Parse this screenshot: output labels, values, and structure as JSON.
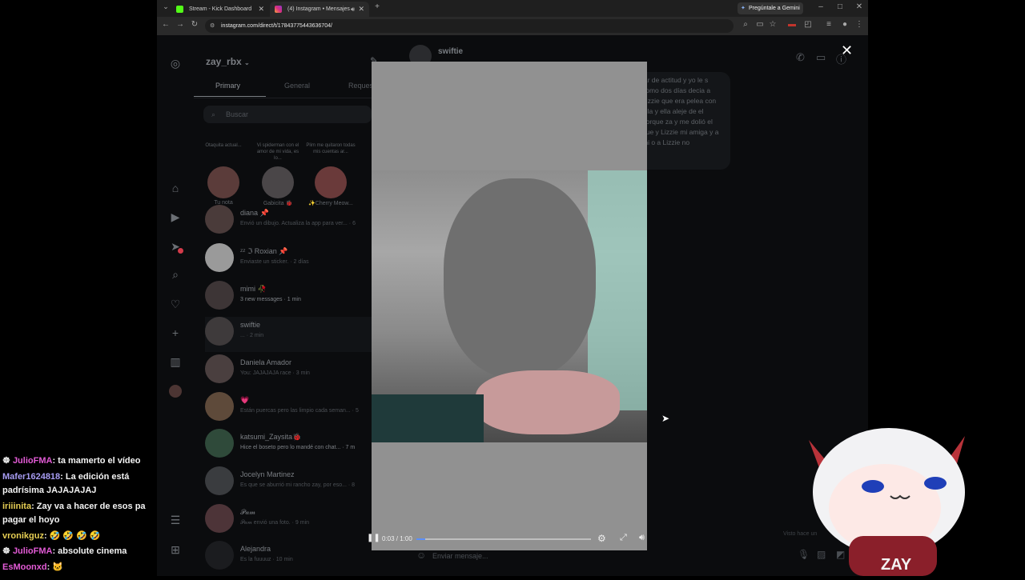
{
  "browser": {
    "tabs": [
      {
        "title": "Stream - Kick Dashboard",
        "icon": "kick-icon"
      },
      {
        "title": "(4) Instagram • Mensajes",
        "icon": "instagram-icon"
      }
    ],
    "gemini_label": "Pregúntale a Gemini",
    "url": "instagram.com/direct/t/17843775443636704/"
  },
  "instagram": {
    "username": "zay_rbx",
    "tabs": [
      "Primary",
      "General",
      "Reques"
    ],
    "search_placeholder": "Buscar",
    "notes": [
      {
        "text": "Otaquita actual...",
        "name": "Tu nota"
      },
      {
        "text": "Vi spiderman con el amor de mi vida, es lo...",
        "name": "Gabicita 🐞"
      },
      {
        "text": "Plim me quitaron todas mis cuentas ar...",
        "name": "✨Cherry Meow..."
      }
    ],
    "conversations": [
      {
        "name": "diana 📌",
        "preview": "Envió un dibujo. Actualiza la app para ver... · 6"
      },
      {
        "name": "ᶻᶻ ℑ Roxian 📌",
        "preview": "Enviaste un sticker. · 2 días"
      },
      {
        "name": "mimi 🥀",
        "preview": "3 new messages · 1 min"
      },
      {
        "name": "swiftie",
        "preview": "... · 2 min"
      },
      {
        "name": "Daniela Amador",
        "preview": "You: JAJAJAJA race · 3 min"
      },
      {
        "name": "💗",
        "preview": "Están puercas pero las limpio cada seman... · 5"
      },
      {
        "name": "katsumi_Zaysita🐞",
        "preview": "Hice el boseto pero lo mandé con chat... · 7 m"
      },
      {
        "name": "Jocelyn Martinez",
        "preview": "Es que se aburrió mi rancho zay, por eso... · 8"
      },
      {
        "name": "𝒫𝒶𝓂",
        "preview": "𝒫𝒶𝓂 envió una foto. · 9 min"
      },
      {
        "name": "Alejandra",
        "preview": "Es la fuuuuz · 10 min"
      }
    ],
    "chat": {
      "name": "swiftie",
      "message": "jar de actitud y yo le s como dos días decia a Lizzie que era pelea con ella y ella aleje de el porque za y me dolió el que y Lizzie mi amiga y a mi o a Lizzie no",
      "composer_placeholder": "Enviar mensaje...",
      "seen_label": "Visto hace un"
    }
  },
  "video": {
    "time": "0:03 / 1:00",
    "progress": 0.05
  },
  "stream_chat": [
    {
      "user": "JulioFMA",
      "color": "#e35bd6",
      "badge": true,
      "text": ": ta mamerto el vídeo"
    },
    {
      "user": "Mafer1624818",
      "color": "#a79cf2",
      "badge": false,
      "text": ": La edición está padrísima JAJAJAJAJ"
    },
    {
      "user": "iriiinita",
      "color": "#e7cf54",
      "badge": false,
      "text": ": Zay va a hacer de esos pa pagar el hoyo"
    },
    {
      "user": "vronikguz",
      "color": "#e7cf54",
      "badge": false,
      "text": ": 🤣 🤣 🤣 🤣"
    },
    {
      "user": "JulioFMA",
      "color": "#e35bd6",
      "badge": true,
      "text": ": absolute cinema"
    },
    {
      "user": "EsMoonxd",
      "color": "#e35bd6",
      "badge": false,
      "text": ": 🐱"
    }
  ],
  "mascot": {
    "label": "ZAY"
  }
}
